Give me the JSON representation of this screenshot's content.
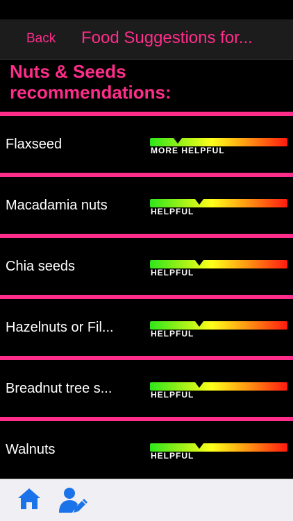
{
  "nav": {
    "back_label": "Back",
    "title": "Food Suggestions for..."
  },
  "heading": "Nuts & Seeds recommendations:",
  "items": [
    {
      "name": "Flaxseed",
      "rating": "MORE HELPFUL",
      "level": 0.2
    },
    {
      "name": "Macadamia nuts",
      "rating": "HELPFUL",
      "level": 0.36
    },
    {
      "name": "Chia seeds",
      "rating": "HELPFUL",
      "level": 0.36
    },
    {
      "name": "Hazelnuts or Fil...",
      "rating": "HELPFUL",
      "level": 0.36
    },
    {
      "name": "Breadnut tree s...",
      "rating": "HELPFUL",
      "level": 0.36
    },
    {
      "name": "Walnuts",
      "rating": "HELPFUL",
      "level": 0.36
    }
  ],
  "tabs": [
    {
      "icon": "home-icon"
    },
    {
      "icon": "user-edit-icon"
    }
  ],
  "colors": {
    "accent": "#ff2d8a",
    "tab_icon": "#1a73e8"
  }
}
